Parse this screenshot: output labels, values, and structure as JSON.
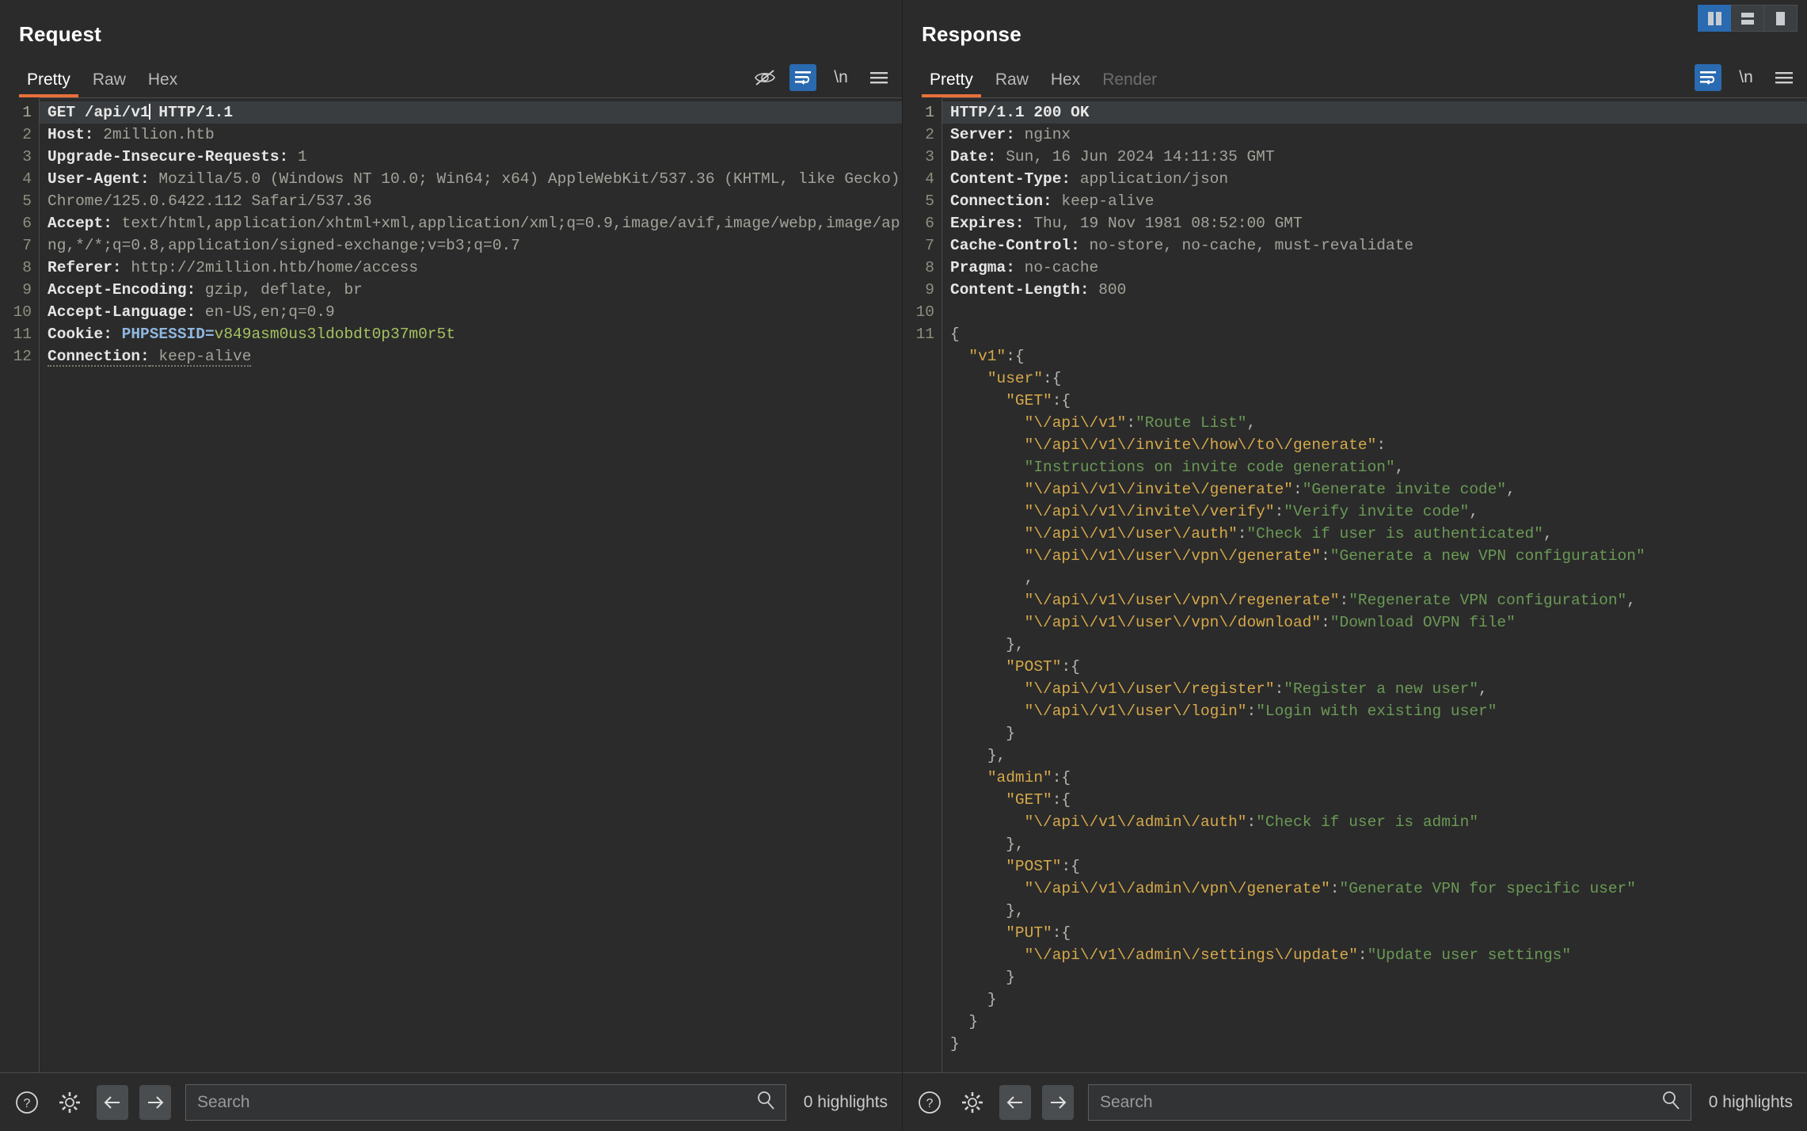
{
  "window": {
    "layout_toggles": [
      {
        "name": "vertical-split",
        "active": true
      },
      {
        "name": "horizontal-split",
        "active": false
      },
      {
        "name": "single-pane",
        "active": false
      }
    ]
  },
  "request": {
    "title": "Request",
    "tabs": [
      {
        "label": "Pretty",
        "active": true,
        "disabled": false
      },
      {
        "label": "Raw",
        "active": false,
        "disabled": false
      },
      {
        "label": "Hex",
        "active": false,
        "disabled": false
      }
    ],
    "icons": [
      {
        "name": "eye-off-icon",
        "active": false
      },
      {
        "name": "word-wrap-icon",
        "active": true
      },
      {
        "name": "newline-icon",
        "label": "\\n",
        "active": false
      },
      {
        "name": "menu-icon",
        "active": false
      }
    ],
    "gutter": [
      "1",
      "2",
      "3",
      "4",
      "5",
      "6",
      "7",
      "8",
      "9",
      "10",
      "11",
      "12"
    ],
    "lines": [
      {
        "type": "request-line",
        "method": "GET",
        "path": "/api/v1",
        "version": "HTTP/1.1",
        "caret_after_path": true
      },
      {
        "type": "header",
        "name": "Host:",
        "value": " 2million.htb"
      },
      {
        "type": "header",
        "name": "Upgrade-Insecure-Requests:",
        "value": " 1"
      },
      {
        "type": "header",
        "name": "User-Agent:",
        "value": " Mozilla/5.0 (Windows NT 10.0; Win64; x64) AppleWebKit/537.36 (KHTML, like Gecko) Chrome/125.0.6422.112 Safari/537.36"
      },
      {
        "type": "header",
        "name": "Accept:",
        "value": " text/html,application/xhtml+xml,application/xml;q=0.9,image/avif,image/webp,image/apng,*/*;q=0.8,application/signed-exchange;v=b3;q=0.7"
      },
      {
        "type": "header",
        "name": "Referer:",
        "value": " http://2million.htb/home/access"
      },
      {
        "type": "header",
        "name": "Accept-Encoding:",
        "value": " gzip, deflate, br"
      },
      {
        "type": "header",
        "name": "Accept-Language:",
        "value": " en-US,en;q=0.9"
      },
      {
        "type": "cookie",
        "name": "Cookie:",
        "cookie_name": " PHPSESSID=",
        "cookie_value": "v849asm0us3ldobdt0p37m0r5t"
      },
      {
        "type": "header-underlined",
        "name": "Connection:",
        "value": " keep-alive"
      },
      {
        "type": "blank"
      },
      {
        "type": "blank"
      }
    ],
    "search": {
      "placeholder": "Search",
      "value": ""
    },
    "highlights": "0 highlights"
  },
  "response": {
    "title": "Response",
    "tabs": [
      {
        "label": "Pretty",
        "active": true,
        "disabled": false
      },
      {
        "label": "Raw",
        "active": false,
        "disabled": false
      },
      {
        "label": "Hex",
        "active": false,
        "disabled": false
      },
      {
        "label": "Render",
        "active": false,
        "disabled": true
      }
    ],
    "icons": [
      {
        "name": "word-wrap-icon",
        "active": true
      },
      {
        "name": "newline-icon",
        "label": "\\n",
        "active": false
      },
      {
        "name": "menu-icon",
        "active": false
      }
    ],
    "gutter": [
      "1",
      "2",
      "3",
      "4",
      "5",
      "6",
      "7",
      "8",
      "9",
      "10",
      "11"
    ],
    "headers": [
      {
        "type": "status",
        "text": "HTTP/1.1 200 OK"
      },
      {
        "type": "header",
        "name": "Server:",
        "value": " nginx"
      },
      {
        "type": "header",
        "name": "Date:",
        "value": " Sun, 16 Jun 2024 14:11:35 GMT"
      },
      {
        "type": "header",
        "name": "Content-Type:",
        "value": " application/json"
      },
      {
        "type": "header",
        "name": "Connection:",
        "value": " keep-alive"
      },
      {
        "type": "header",
        "name": "Expires:",
        "value": " Thu, 19 Nov 1981 08:52:00 GMT"
      },
      {
        "type": "header",
        "name": "Cache-Control:",
        "value": " no-store, no-cache, must-revalidate"
      },
      {
        "type": "header",
        "name": "Pragma:",
        "value": " no-cache"
      },
      {
        "type": "header",
        "name": "Content-Length:",
        "value": " 800"
      },
      {
        "type": "blank"
      }
    ],
    "body_lines": [
      {
        "indent": 0,
        "parts": [
          {
            "t": "punct",
            "v": "{"
          }
        ]
      },
      {
        "indent": 1,
        "parts": [
          {
            "t": "key",
            "v": "\"v1\""
          },
          {
            "t": "punct",
            "v": ":{"
          }
        ]
      },
      {
        "indent": 2,
        "parts": [
          {
            "t": "key",
            "v": "\"user\""
          },
          {
            "t": "punct",
            "v": ":{"
          }
        ]
      },
      {
        "indent": 3,
        "parts": [
          {
            "t": "key",
            "v": "\"GET\""
          },
          {
            "t": "punct",
            "v": ":{"
          }
        ]
      },
      {
        "indent": 4,
        "parts": [
          {
            "t": "key",
            "v": "\"\\/api\\/v1\""
          },
          {
            "t": "punct",
            "v": ":"
          },
          {
            "t": "str",
            "v": "\"Route List\""
          },
          {
            "t": "punct",
            "v": ","
          }
        ]
      },
      {
        "indent": 4,
        "parts": [
          {
            "t": "key",
            "v": "\"\\/api\\/v1\\/invite\\/how\\/to\\/generate\""
          },
          {
            "t": "punct",
            "v": ":"
          }
        ]
      },
      {
        "indent": 4,
        "parts": [
          {
            "t": "str",
            "v": "\"Instructions on invite code generation\""
          },
          {
            "t": "punct",
            "v": ","
          }
        ]
      },
      {
        "indent": 4,
        "parts": [
          {
            "t": "key",
            "v": "\"\\/api\\/v1\\/invite\\/generate\""
          },
          {
            "t": "punct",
            "v": ":"
          },
          {
            "t": "str",
            "v": "\"Generate invite code\""
          },
          {
            "t": "punct",
            "v": ","
          }
        ]
      },
      {
        "indent": 4,
        "parts": [
          {
            "t": "key",
            "v": "\"\\/api\\/v1\\/invite\\/verify\""
          },
          {
            "t": "punct",
            "v": ":"
          },
          {
            "t": "str",
            "v": "\"Verify invite code\""
          },
          {
            "t": "punct",
            "v": ","
          }
        ]
      },
      {
        "indent": 4,
        "parts": [
          {
            "t": "key",
            "v": "\"\\/api\\/v1\\/user\\/auth\""
          },
          {
            "t": "punct",
            "v": ":"
          },
          {
            "t": "str",
            "v": "\"Check if user is authenticated\""
          },
          {
            "t": "punct",
            "v": ","
          }
        ]
      },
      {
        "indent": 4,
        "parts": [
          {
            "t": "key",
            "v": "\"\\/api\\/v1\\/user\\/vpn\\/generate\""
          },
          {
            "t": "punct",
            "v": ":"
          },
          {
            "t": "str",
            "v": "\"Generate a new VPN configuration\""
          }
        ]
      },
      {
        "indent": 4,
        "parts": [
          {
            "t": "punct",
            "v": ","
          }
        ]
      },
      {
        "indent": 4,
        "parts": [
          {
            "t": "key",
            "v": "\"\\/api\\/v1\\/user\\/vpn\\/regenerate\""
          },
          {
            "t": "punct",
            "v": ":"
          },
          {
            "t": "str",
            "v": "\"Regenerate VPN configuration\""
          },
          {
            "t": "punct",
            "v": ","
          }
        ]
      },
      {
        "indent": 4,
        "parts": [
          {
            "t": "key",
            "v": "\"\\/api\\/v1\\/user\\/vpn\\/download\""
          },
          {
            "t": "punct",
            "v": ":"
          },
          {
            "t": "str",
            "v": "\"Download OVPN file\""
          }
        ]
      },
      {
        "indent": 3,
        "parts": [
          {
            "t": "punct",
            "v": "},"
          }
        ]
      },
      {
        "indent": 3,
        "parts": [
          {
            "t": "key",
            "v": "\"POST\""
          },
          {
            "t": "punct",
            "v": ":{"
          }
        ]
      },
      {
        "indent": 4,
        "parts": [
          {
            "t": "key",
            "v": "\"\\/api\\/v1\\/user\\/register\""
          },
          {
            "t": "punct",
            "v": ":"
          },
          {
            "t": "str",
            "v": "\"Register a new user\""
          },
          {
            "t": "punct",
            "v": ","
          }
        ]
      },
      {
        "indent": 4,
        "parts": [
          {
            "t": "key",
            "v": "\"\\/api\\/v1\\/user\\/login\""
          },
          {
            "t": "punct",
            "v": ":"
          },
          {
            "t": "str",
            "v": "\"Login with existing user\""
          }
        ]
      },
      {
        "indent": 3,
        "parts": [
          {
            "t": "punct",
            "v": "}"
          }
        ]
      },
      {
        "indent": 2,
        "parts": [
          {
            "t": "punct",
            "v": "},"
          }
        ]
      },
      {
        "indent": 2,
        "parts": [
          {
            "t": "key",
            "v": "\"admin\""
          },
          {
            "t": "punct",
            "v": ":{"
          }
        ]
      },
      {
        "indent": 3,
        "parts": [
          {
            "t": "key",
            "v": "\"GET\""
          },
          {
            "t": "punct",
            "v": ":{"
          }
        ]
      },
      {
        "indent": 4,
        "parts": [
          {
            "t": "key",
            "v": "\"\\/api\\/v1\\/admin\\/auth\""
          },
          {
            "t": "punct",
            "v": ":"
          },
          {
            "t": "str",
            "v": "\"Check if user is admin\""
          }
        ]
      },
      {
        "indent": 3,
        "parts": [
          {
            "t": "punct",
            "v": "},"
          }
        ]
      },
      {
        "indent": 3,
        "parts": [
          {
            "t": "key",
            "v": "\"POST\""
          },
          {
            "t": "punct",
            "v": ":{"
          }
        ]
      },
      {
        "indent": 4,
        "parts": [
          {
            "t": "key",
            "v": "\"\\/api\\/v1\\/admin\\/vpn\\/generate\""
          },
          {
            "t": "punct",
            "v": ":"
          },
          {
            "t": "str",
            "v": "\"Generate VPN for specific user\""
          }
        ]
      },
      {
        "indent": 3,
        "parts": [
          {
            "t": "punct",
            "v": "},"
          }
        ]
      },
      {
        "indent": 3,
        "parts": [
          {
            "t": "key",
            "v": "\"PUT\""
          },
          {
            "t": "punct",
            "v": ":{"
          }
        ]
      },
      {
        "indent": 4,
        "parts": [
          {
            "t": "key",
            "v": "\"\\/api\\/v1\\/admin\\/settings\\/update\""
          },
          {
            "t": "punct",
            "v": ":"
          },
          {
            "t": "str",
            "v": "\"Update user settings\""
          }
        ]
      },
      {
        "indent": 3,
        "parts": [
          {
            "t": "punct",
            "v": "}"
          }
        ]
      },
      {
        "indent": 2,
        "parts": [
          {
            "t": "punct",
            "v": "}"
          }
        ]
      },
      {
        "indent": 1,
        "parts": [
          {
            "t": "punct",
            "v": "}"
          }
        ]
      },
      {
        "indent": 0,
        "parts": [
          {
            "t": "punct",
            "v": "}"
          }
        ]
      }
    ],
    "search": {
      "placeholder": "Search",
      "value": ""
    },
    "highlights": "0 highlights"
  }
}
